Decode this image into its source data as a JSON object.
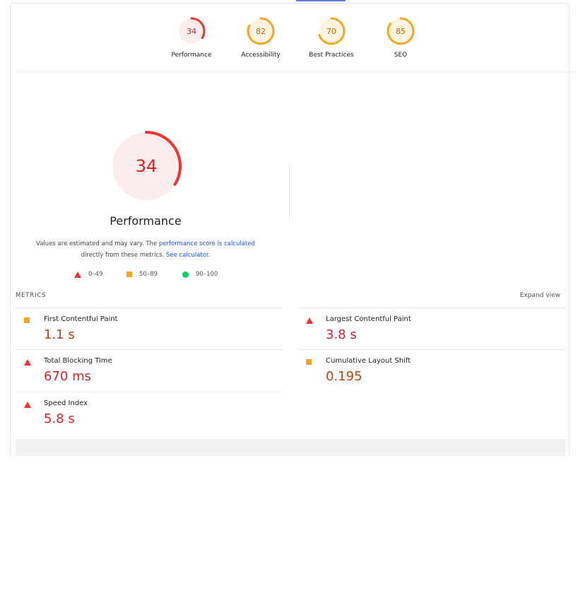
{
  "summary": {
    "categories": [
      {
        "label": "Performance",
        "score": "34",
        "fraction": 0.34,
        "color": "#f4322d",
        "bg": "#fdecec"
      },
      {
        "label": "Accessibility",
        "score": "82",
        "fraction": 0.82,
        "color": "#f5a623",
        "bg": "#fff3e0"
      },
      {
        "label": "Best Practices",
        "score": "70",
        "fraction": 0.7,
        "color": "#f5a623",
        "bg": "#fff3e0"
      },
      {
        "label": "SEO",
        "score": "85",
        "fraction": 0.85,
        "color": "#f5a623",
        "bg": "#fff3e0"
      }
    ]
  },
  "performance": {
    "score": "34",
    "fraction": 0.34,
    "title": "Performance",
    "note_prefix": "Values are estimated and may vary. The ",
    "note_link1": "performance score is calculated",
    "note_middle": " directly from these metrics. ",
    "note_link2": "See calculator.",
    "color_fail": "#f4322d",
    "color_average": "#f5a623",
    "color_pass": "#0ccf6b"
  },
  "legend": {
    "fail": "0–49",
    "average": "50–89",
    "pass": "90–100"
  },
  "metrics": {
    "heading": "METRICS",
    "expand_label": "Expand view",
    "items": [
      {
        "name": "First Contentful Paint",
        "value": "1.1 s",
        "rating": "average"
      },
      {
        "name": "Largest Contentful Paint",
        "value": "3.8 s",
        "rating": "fail"
      },
      {
        "name": "Total Blocking Time",
        "value": "670 ms",
        "rating": "fail"
      },
      {
        "name": "Cumulative Layout Shift",
        "value": "0.195",
        "rating": "average"
      },
      {
        "name": "Speed Index",
        "value": "5.8 s",
        "rating": "fail"
      }
    ]
  }
}
